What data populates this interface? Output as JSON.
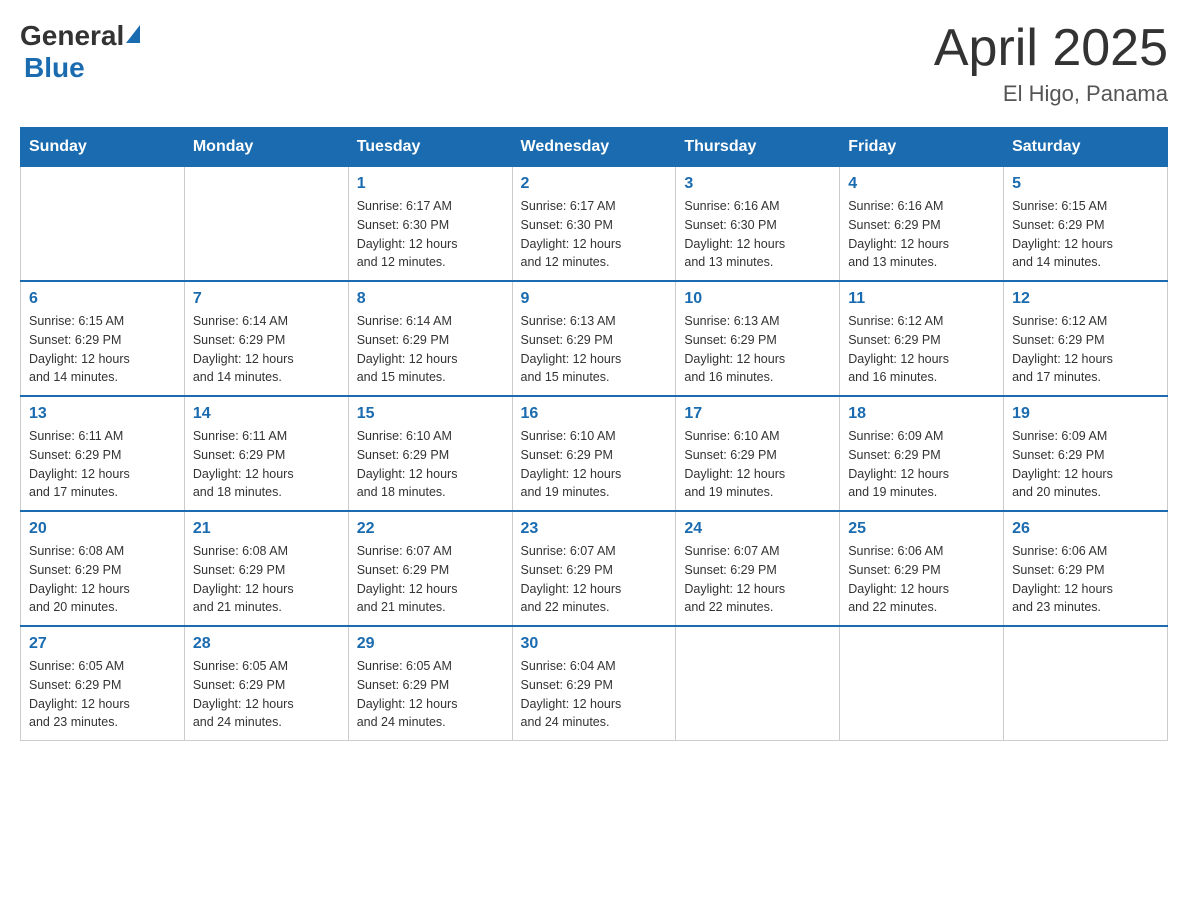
{
  "logo": {
    "general": "General",
    "blue": "Blue"
  },
  "title": "April 2025",
  "subtitle": "El Higo, Panama",
  "days_of_week": [
    "Sunday",
    "Monday",
    "Tuesday",
    "Wednesday",
    "Thursday",
    "Friday",
    "Saturday"
  ],
  "weeks": [
    [
      {
        "day": "",
        "info": ""
      },
      {
        "day": "",
        "info": ""
      },
      {
        "day": "1",
        "info": "Sunrise: 6:17 AM\nSunset: 6:30 PM\nDaylight: 12 hours\nand 12 minutes."
      },
      {
        "day": "2",
        "info": "Sunrise: 6:17 AM\nSunset: 6:30 PM\nDaylight: 12 hours\nand 12 minutes."
      },
      {
        "day": "3",
        "info": "Sunrise: 6:16 AM\nSunset: 6:30 PM\nDaylight: 12 hours\nand 13 minutes."
      },
      {
        "day": "4",
        "info": "Sunrise: 6:16 AM\nSunset: 6:29 PM\nDaylight: 12 hours\nand 13 minutes."
      },
      {
        "day": "5",
        "info": "Sunrise: 6:15 AM\nSunset: 6:29 PM\nDaylight: 12 hours\nand 14 minutes."
      }
    ],
    [
      {
        "day": "6",
        "info": "Sunrise: 6:15 AM\nSunset: 6:29 PM\nDaylight: 12 hours\nand 14 minutes."
      },
      {
        "day": "7",
        "info": "Sunrise: 6:14 AM\nSunset: 6:29 PM\nDaylight: 12 hours\nand 14 minutes."
      },
      {
        "day": "8",
        "info": "Sunrise: 6:14 AM\nSunset: 6:29 PM\nDaylight: 12 hours\nand 15 minutes."
      },
      {
        "day": "9",
        "info": "Sunrise: 6:13 AM\nSunset: 6:29 PM\nDaylight: 12 hours\nand 15 minutes."
      },
      {
        "day": "10",
        "info": "Sunrise: 6:13 AM\nSunset: 6:29 PM\nDaylight: 12 hours\nand 16 minutes."
      },
      {
        "day": "11",
        "info": "Sunrise: 6:12 AM\nSunset: 6:29 PM\nDaylight: 12 hours\nand 16 minutes."
      },
      {
        "day": "12",
        "info": "Sunrise: 6:12 AM\nSunset: 6:29 PM\nDaylight: 12 hours\nand 17 minutes."
      }
    ],
    [
      {
        "day": "13",
        "info": "Sunrise: 6:11 AM\nSunset: 6:29 PM\nDaylight: 12 hours\nand 17 minutes."
      },
      {
        "day": "14",
        "info": "Sunrise: 6:11 AM\nSunset: 6:29 PM\nDaylight: 12 hours\nand 18 minutes."
      },
      {
        "day": "15",
        "info": "Sunrise: 6:10 AM\nSunset: 6:29 PM\nDaylight: 12 hours\nand 18 minutes."
      },
      {
        "day": "16",
        "info": "Sunrise: 6:10 AM\nSunset: 6:29 PM\nDaylight: 12 hours\nand 19 minutes."
      },
      {
        "day": "17",
        "info": "Sunrise: 6:10 AM\nSunset: 6:29 PM\nDaylight: 12 hours\nand 19 minutes."
      },
      {
        "day": "18",
        "info": "Sunrise: 6:09 AM\nSunset: 6:29 PM\nDaylight: 12 hours\nand 19 minutes."
      },
      {
        "day": "19",
        "info": "Sunrise: 6:09 AM\nSunset: 6:29 PM\nDaylight: 12 hours\nand 20 minutes."
      }
    ],
    [
      {
        "day": "20",
        "info": "Sunrise: 6:08 AM\nSunset: 6:29 PM\nDaylight: 12 hours\nand 20 minutes."
      },
      {
        "day": "21",
        "info": "Sunrise: 6:08 AM\nSunset: 6:29 PM\nDaylight: 12 hours\nand 21 minutes."
      },
      {
        "day": "22",
        "info": "Sunrise: 6:07 AM\nSunset: 6:29 PM\nDaylight: 12 hours\nand 21 minutes."
      },
      {
        "day": "23",
        "info": "Sunrise: 6:07 AM\nSunset: 6:29 PM\nDaylight: 12 hours\nand 22 minutes."
      },
      {
        "day": "24",
        "info": "Sunrise: 6:07 AM\nSunset: 6:29 PM\nDaylight: 12 hours\nand 22 minutes."
      },
      {
        "day": "25",
        "info": "Sunrise: 6:06 AM\nSunset: 6:29 PM\nDaylight: 12 hours\nand 22 minutes."
      },
      {
        "day": "26",
        "info": "Sunrise: 6:06 AM\nSunset: 6:29 PM\nDaylight: 12 hours\nand 23 minutes."
      }
    ],
    [
      {
        "day": "27",
        "info": "Sunrise: 6:05 AM\nSunset: 6:29 PM\nDaylight: 12 hours\nand 23 minutes."
      },
      {
        "day": "28",
        "info": "Sunrise: 6:05 AM\nSunset: 6:29 PM\nDaylight: 12 hours\nand 24 minutes."
      },
      {
        "day": "29",
        "info": "Sunrise: 6:05 AM\nSunset: 6:29 PM\nDaylight: 12 hours\nand 24 minutes."
      },
      {
        "day": "30",
        "info": "Sunrise: 6:04 AM\nSunset: 6:29 PM\nDaylight: 12 hours\nand 24 minutes."
      },
      {
        "day": "",
        "info": ""
      },
      {
        "day": "",
        "info": ""
      },
      {
        "day": "",
        "info": ""
      }
    ]
  ]
}
